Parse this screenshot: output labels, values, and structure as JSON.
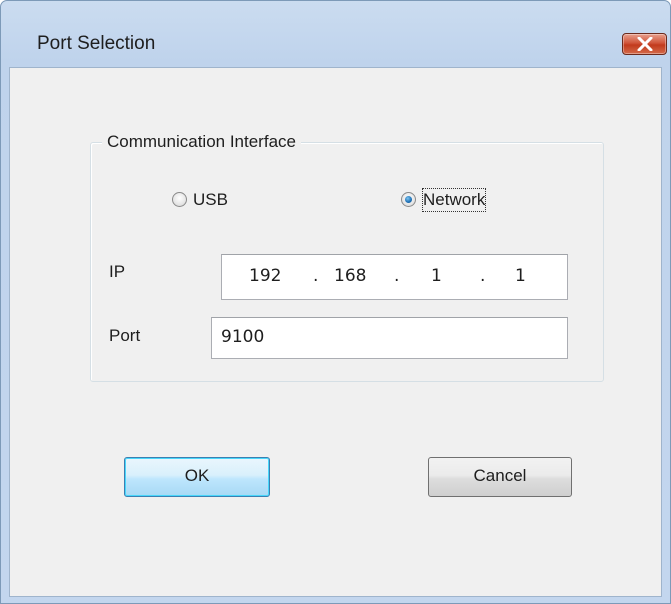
{
  "window": {
    "title": "Port Selection",
    "close_label": "✕"
  },
  "group": {
    "label": "Communication Interface"
  },
  "interface": {
    "options": [
      {
        "label": "USB",
        "checked": false
      },
      {
        "label": "Network",
        "checked": true
      }
    ]
  },
  "ip": {
    "label": "IP",
    "octets": [
      "192",
      "168",
      "1",
      "1"
    ]
  },
  "port": {
    "label": "Port",
    "value": "9100"
  },
  "buttons": {
    "ok_label": "OK",
    "cancel_label": "Cancel"
  },
  "colors": {
    "frame": "#c3d6ee",
    "client": "#f0f0f0",
    "close_red": "#c23a1c",
    "default_button_border": "#3c7fb1"
  }
}
